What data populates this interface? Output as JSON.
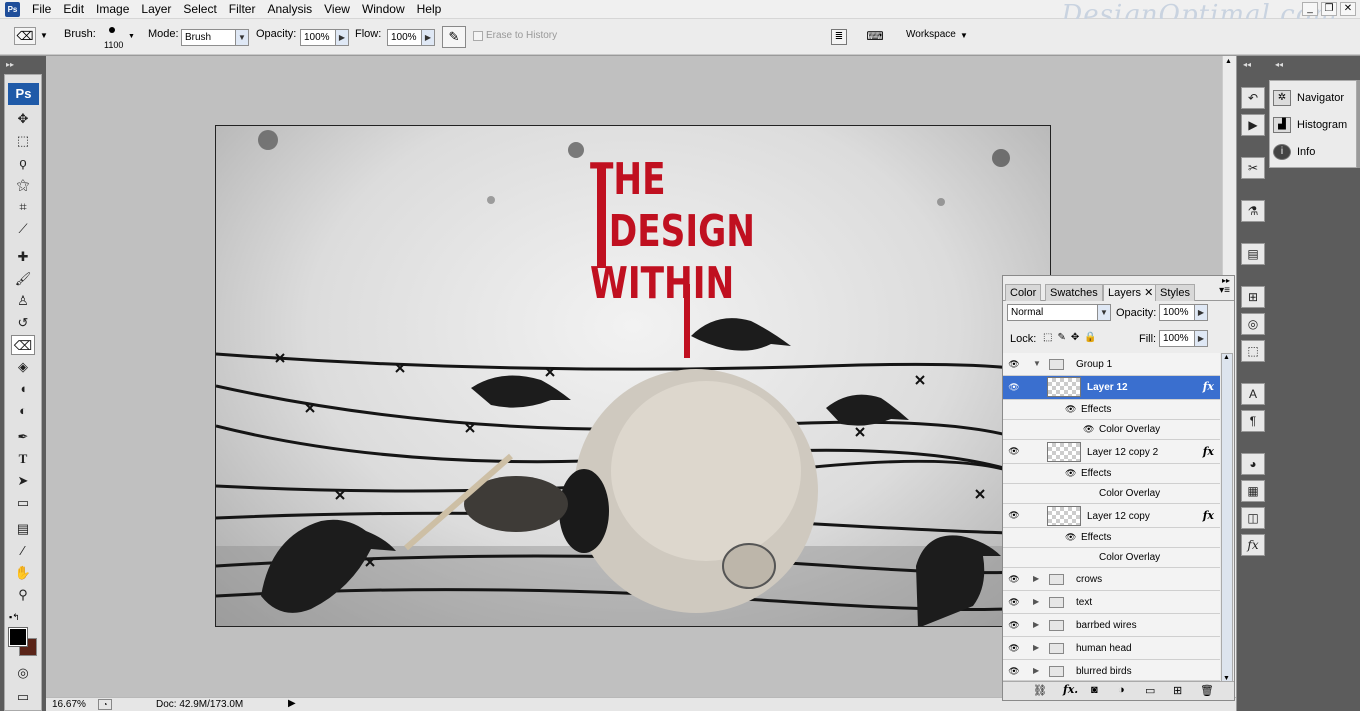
{
  "menubar": {
    "logo": "Ps",
    "items": [
      "File",
      "Edit",
      "Image",
      "Layer",
      "Select",
      "Filter",
      "Analysis",
      "View",
      "Window",
      "Help"
    ],
    "watermark": "DesignOptimal.com"
  },
  "options": {
    "brush_label": "Brush:",
    "brush_size": "1100",
    "mode_label": "Mode:",
    "mode_value": "Brush",
    "opacity_label": "Opacity:",
    "opacity_value": "100%",
    "flow_label": "Flow:",
    "flow_value": "100%",
    "erase_history_label": "Erase to History",
    "workspace_label": "Workspace"
  },
  "toolbar": {
    "badge": "Ps"
  },
  "canvas": {
    "title_lines": [
      "THE",
      "DESIGN",
      "WITHIN"
    ],
    "accent": "#c01020"
  },
  "status": {
    "zoom": "16.67%",
    "doc": "Doc: 42.9M/173.0M"
  },
  "side_panel": {
    "items": [
      "Navigator",
      "Histogram",
      "Info"
    ]
  },
  "layers_panel": {
    "tabs": [
      "Color",
      "Swatches",
      "Layers",
      "Styles"
    ],
    "active_tab": "Layers",
    "blend_mode": "Normal",
    "opacity_label": "Opacity:",
    "opacity_value": "100%",
    "lock_label": "Lock:",
    "fill_label": "Fill:",
    "fill_value": "100%",
    "group_name": "Group 1",
    "layers": [
      {
        "name": "Layer 12",
        "selected": true
      },
      {
        "name": "Layer 12 copy 2",
        "selected": false
      },
      {
        "name": "Layer 12 copy",
        "selected": false
      }
    ],
    "effects_label": "Effects",
    "effect_name": "Color Overlay",
    "groups": [
      "crows",
      "text",
      "barrbed wires",
      "human head",
      "blurred birds"
    ]
  }
}
